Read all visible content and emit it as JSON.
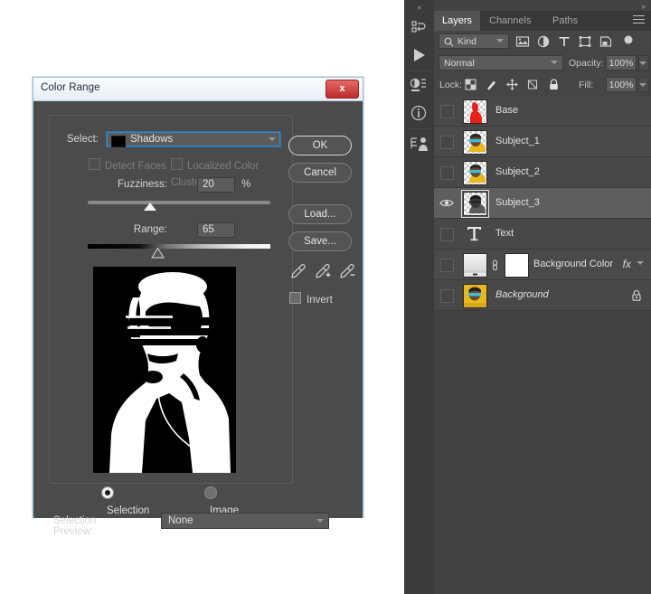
{
  "dialog": {
    "title": "Color Range",
    "close_label": "x",
    "select_label": "Select:",
    "select_value": "Shadows",
    "select_swatch_color": "#000000",
    "detect_faces_label": "Detect Faces",
    "localized_color_clusters_label": "Localized Color Clusters",
    "fuzziness_label": "Fuzziness:",
    "fuzziness_value": "20",
    "fuzziness_unit": "%",
    "range_label": "Range:",
    "range_value": "65",
    "buttons": {
      "ok": "OK",
      "cancel": "Cancel",
      "load": "Load...",
      "save": "Save..."
    },
    "eyedroppers": [
      "eyedropper-icon",
      "eyedropper-add-icon",
      "eyedropper-subtract-icon"
    ],
    "invert_label": "Invert",
    "invert_checked": false,
    "preview_radio": [
      {
        "label": "Selection",
        "selected": true
      },
      {
        "label": "Image",
        "selected": false
      }
    ],
    "selection_preview_label": "Selection Preview:",
    "selection_preview_value": "None",
    "preview_description": "black-and-white selection mask of a person wearing shutter shades"
  },
  "panel": {
    "collapse_icon": "«",
    "expand_icon": "»",
    "tabs": [
      {
        "label": "Layers",
        "active": true
      },
      {
        "label": "Channels",
        "active": false
      },
      {
        "label": "Paths",
        "active": false
      }
    ],
    "menu_icon": "panel-menu-icon",
    "filter": {
      "kind_label": "Kind",
      "search_icon": "search-icon",
      "icons": [
        "filter-pixel-icon",
        "filter-adjustment-icon",
        "filter-type-icon",
        "filter-shape-icon",
        "filter-smart-object-icon",
        "filter-toggle-icon"
      ]
    },
    "blend": {
      "mode": "Normal",
      "opacity_label": "Opacity:",
      "opacity_value": "100%"
    },
    "lock": {
      "label": "Lock:",
      "icons": [
        "lock-transparency-icon",
        "lock-image-icon",
        "lock-position-icon",
        "lock-artboard-icon",
        "lock-all-icon"
      ],
      "fill_label": "Fill:",
      "fill_value": "100%"
    },
    "layers": [
      {
        "name": "Base",
        "visible": false,
        "selected": false,
        "locked": false,
        "italic": false,
        "thumb": "red-silhouette",
        "kind": "pixel"
      },
      {
        "name": "Subject_1",
        "visible": false,
        "selected": false,
        "locked": false,
        "italic": false,
        "thumb": "portrait-color",
        "kind": "pixel"
      },
      {
        "name": "Subject_2",
        "visible": false,
        "selected": false,
        "locked": false,
        "italic": false,
        "thumb": "portrait-color",
        "kind": "pixel"
      },
      {
        "name": "Subject_3",
        "visible": true,
        "selected": true,
        "locked": false,
        "italic": false,
        "thumb": "portrait-gray",
        "kind": "pixel"
      },
      {
        "name": "Text",
        "visible": false,
        "selected": false,
        "locked": false,
        "italic": false,
        "thumb": "type-glyph",
        "kind": "type"
      },
      {
        "name": "Background Color",
        "visible": false,
        "selected": false,
        "locked": false,
        "italic": false,
        "thumb": "gradient-fill",
        "kind": "fill",
        "has_mask": true,
        "has_fx": true,
        "fx_label": "fx"
      },
      {
        "name": "Background",
        "visible": false,
        "selected": false,
        "locked": true,
        "italic": true,
        "thumb": "portrait-color",
        "kind": "pixel"
      }
    ],
    "rail_icons": [
      "history-icon",
      "actions-play-icon",
      "adjustments-icon",
      "info-icon",
      "layer-comps-icon"
    ]
  }
}
